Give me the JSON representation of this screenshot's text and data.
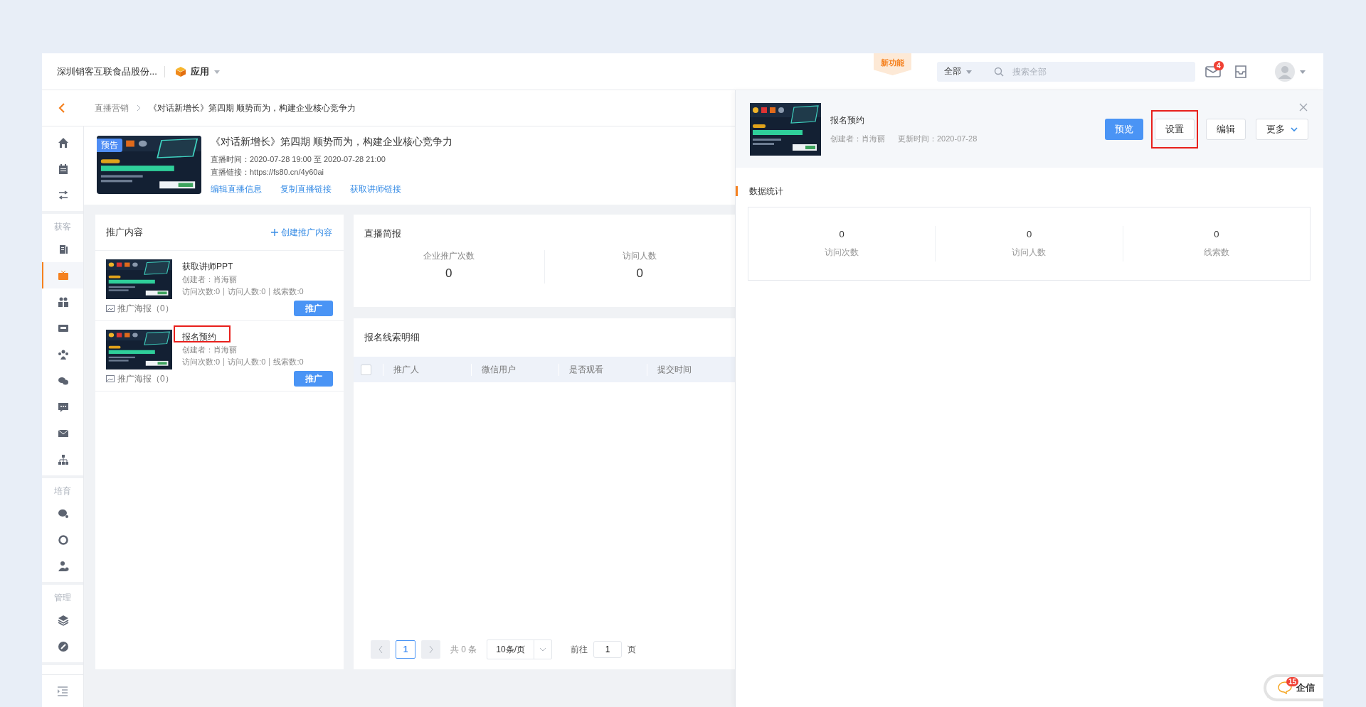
{
  "topbar": {
    "company": "深圳销客互联食品股份...",
    "app_menu": "应用",
    "new_feature_tag": "新功能",
    "search": {
      "scope": "全部",
      "placeholder": "搜索全部"
    },
    "mail_badge": "4"
  },
  "breadcrumb": [
    "直播营销",
    "《对话新增长》第四期 顺势而为，构建企业核心竞争力"
  ],
  "sidebar": {
    "sections": [
      {
        "items": [
          {
            "selected": false
          },
          {
            "selected": false
          },
          {
            "selected": false
          }
        ]
      },
      {
        "title": "获客",
        "items": [
          {
            "selected": false
          },
          {
            "selected": true
          },
          {
            "selected": false
          },
          {
            "selected": false
          },
          {
            "selected": false
          },
          {
            "selected": false
          },
          {
            "selected": false
          },
          {
            "selected": false
          },
          {
            "selected": false
          }
        ]
      },
      {
        "title": "培育",
        "items": [
          {
            "selected": false
          },
          {
            "selected": false
          },
          {
            "selected": false
          }
        ]
      },
      {
        "title": "管理",
        "items": [
          {
            "selected": false
          },
          {
            "selected": false
          }
        ]
      }
    ]
  },
  "live": {
    "badge": "预告",
    "title": "《对话新增长》第四期 顺势而为，构建企业核心竞争力",
    "time": "直播时间：2020-07-28 19:00 至 2020-07-28 21:00",
    "link": "直播链接：https://fs80.cn/4y60ai",
    "actions": [
      "编辑直播信息",
      "复制直播链接",
      "获取讲师链接"
    ]
  },
  "promo": {
    "title": "推广内容",
    "create": "创建推广内容",
    "items": [
      {
        "name": "获取讲师PPT",
        "creator": "创建者：肖海丽",
        "stats": [
          "访问次数:0",
          "访问人数:0",
          "线索数:0"
        ],
        "poster": "推广海报（0）",
        "button": "推广",
        "highlighted": false
      },
      {
        "name": "报名预约",
        "creator": "创建者：肖海丽",
        "stats": [
          "访问次数:0",
          "访问人数:0",
          "线索数:0"
        ],
        "poster": "推广海报（0）",
        "button": "推广",
        "highlighted": true
      }
    ]
  },
  "brief": {
    "title": "直播简报",
    "metrics": [
      {
        "label": "企业推广次数",
        "value": "0"
      },
      {
        "label": "访问人数",
        "value": "0"
      }
    ]
  },
  "leads": {
    "title": "报名线索明细",
    "select_all": {
      "checked": false
    },
    "columns": [
      "推广人",
      "微信用户",
      "是否观看",
      "提交时间"
    ],
    "pagination": {
      "pages": [
        {
          "label": "1",
          "selected": true
        }
      ],
      "total": "共 0 条",
      "page_size": "10条/页",
      "goto_label": "前往",
      "goto_value": "1",
      "goto_suffix": "页"
    }
  },
  "drawer": {
    "title": "报名预约",
    "creator": "创建者：肖海丽",
    "updated": "更新时间：2020-07-28",
    "buttons": [
      {
        "label": "预览",
        "kind": "primary",
        "highlighted": false
      },
      {
        "label": "设置",
        "kind": "default",
        "highlighted": true
      },
      {
        "label": "编辑",
        "kind": "default",
        "highlighted": false
      },
      {
        "label": "更多",
        "kind": "dropdown",
        "highlighted": false
      }
    ],
    "section_title": "数据统计",
    "stats": [
      {
        "value": "0",
        "label": "访问次数"
      },
      {
        "value": "0",
        "label": "访问人数"
      },
      {
        "value": "0",
        "label": "线索数"
      }
    ]
  },
  "chat_widget": {
    "label": "企信",
    "badge": "15"
  }
}
